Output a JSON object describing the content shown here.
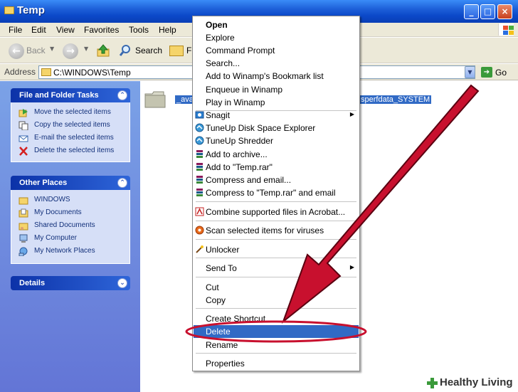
{
  "window": {
    "title": "Temp",
    "min": "_",
    "max": "□",
    "close": "×"
  },
  "menubar": {
    "items": [
      "File",
      "Edit",
      "View",
      "Favorites",
      "Tools",
      "Help"
    ]
  },
  "toolbar": {
    "back": "Back",
    "search": "Search",
    "folders_partial": "F"
  },
  "address": {
    "label": "Address",
    "path": "C:\\WINDOWS\\Temp",
    "go": "Go"
  },
  "taskpane": {
    "file_tasks": {
      "title": "File and Folder Tasks",
      "items": [
        "Move the selected items",
        "Copy the selected items",
        "E-mail the selected items",
        "Delete the selected items"
      ]
    },
    "other_places": {
      "title": "Other Places",
      "items": [
        "WINDOWS",
        "My Documents",
        "Shared Documents",
        "My Computer",
        "My Network Places"
      ]
    },
    "details": {
      "title": "Details"
    }
  },
  "content": {
    "selected_left": "_ava",
    "selected_right": "sperfdata_SYSTEM"
  },
  "context_menu": {
    "items": [
      "Open",
      "Explore",
      "Command Prompt",
      "Search...",
      "Add to Winamp's Bookmark list",
      "Enqueue in Winamp",
      "Play in Winamp",
      "Snagit",
      "TuneUp Disk Space Explorer",
      "TuneUp Shredder",
      "Add to archive...",
      "Add to \"Temp.rar\"",
      "Compress and email...",
      "Compress to \"Temp.rar\" and email",
      "Combine supported files in Acrobat...",
      "Scan selected items for viruses",
      "Unlocker",
      "Send To",
      "Cut",
      "Copy",
      "Create Shortcut",
      "Delete",
      "Rename",
      "Properties"
    ],
    "highlighted": "Delete"
  },
  "watermark": {
    "text": "Healthy Living"
  },
  "colors": {
    "titlebar": "#0b48c8",
    "highlight": "#316ac5",
    "annotation": "#c8102e"
  }
}
